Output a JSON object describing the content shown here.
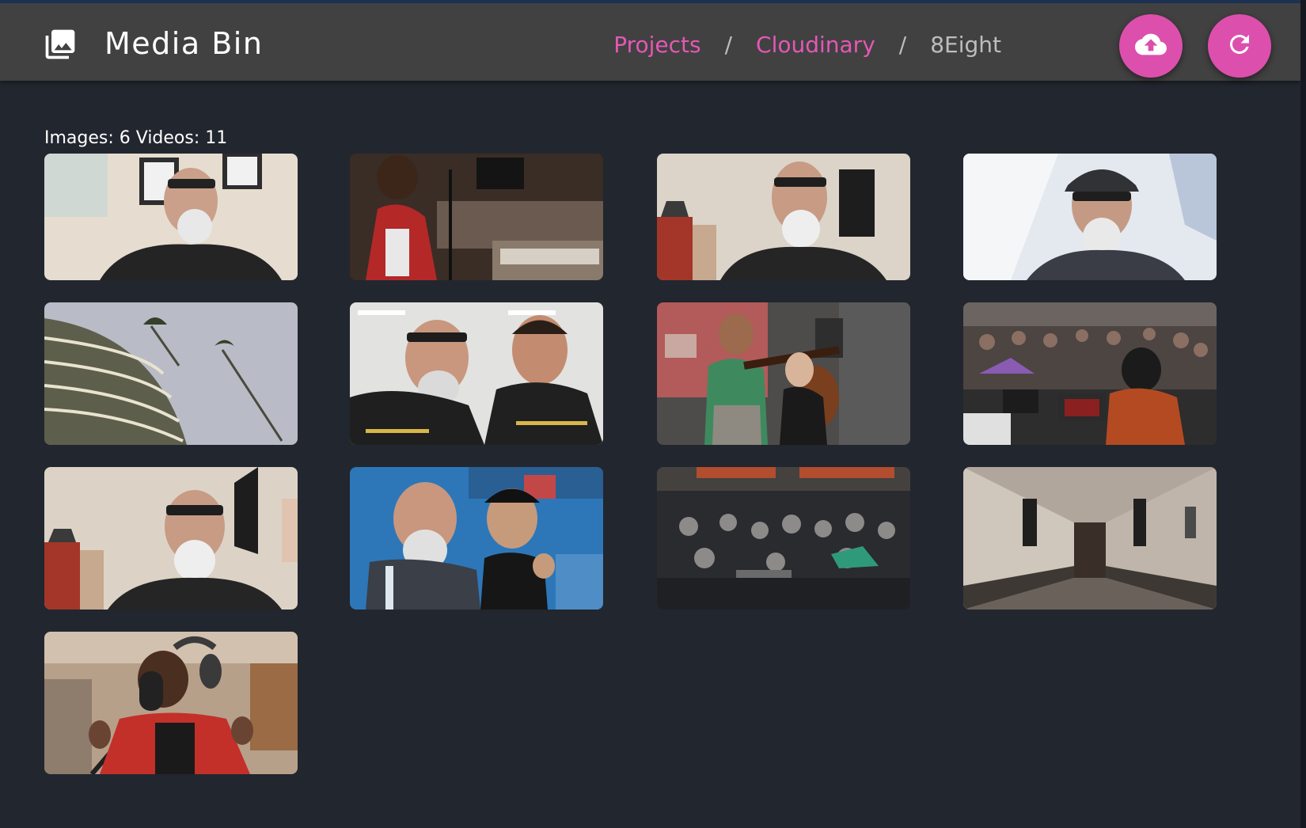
{
  "app": {
    "title": "Media Bin",
    "logo_icon": "photo-library-icon"
  },
  "breadcrumb": [
    {
      "label": "Projects",
      "link": true
    },
    {
      "label": "Cloudinary",
      "link": true
    },
    {
      "label": "8Eight",
      "link": false
    }
  ],
  "actions": {
    "upload_icon": "cloud-upload-icon",
    "refresh_icon": "refresh-icon"
  },
  "counts": {
    "text": "Images: 6 Videos: 11"
  },
  "colors": {
    "accent": "#dd4fad",
    "link": "#e458b5",
    "background": "#22262f",
    "app_bar": "#414141"
  },
  "media": [
    {
      "type": "bearded-man-office"
    },
    {
      "type": "studio-singer"
    },
    {
      "type": "bearded-man-room"
    },
    {
      "type": "bearded-man-cap"
    },
    {
      "type": "round-tower"
    },
    {
      "type": "two-men-selfie"
    },
    {
      "type": "violinist"
    },
    {
      "type": "hackathon-laptops"
    },
    {
      "type": "bearded-man-room"
    },
    {
      "type": "two-men-conference"
    },
    {
      "type": "hackathon-hall"
    },
    {
      "type": "hallway"
    },
    {
      "type": "studio-singer-mic"
    }
  ]
}
